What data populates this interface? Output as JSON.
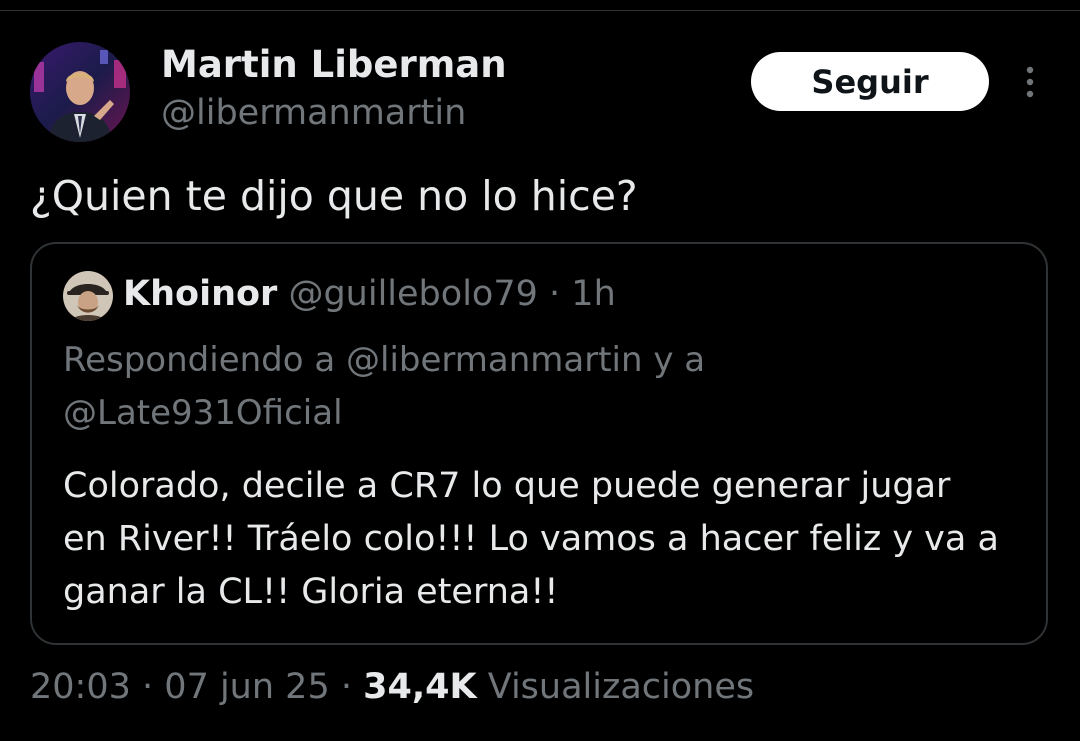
{
  "author": {
    "name": "Martin Liberman",
    "handle": "@libermanmartin"
  },
  "follow_button_label": "Seguir",
  "more_icon": "more-vertical-icon",
  "tweet": {
    "text": "¿Quien te dijo que no lo hice?"
  },
  "quote": {
    "author_name": "Khoinor",
    "author_handle": "@guillebolo79",
    "separator": "·",
    "time": "1h",
    "reply_prefix": "Respondiendo a",
    "reply_user_1": "@libermanmartin",
    "reply_join": "y a",
    "reply_user_2": "@Late931Oficial",
    "body_line_1": "Colorado, decile a CR7 lo que puede generar jugar",
    "body_line_2": "en River!! Tráelo colo!!! Lo vamos a hacer feliz y va a",
    "body_line_3": "ganar la CL!! Gloria eterna!!"
  },
  "meta": {
    "time": "20:03",
    "separator": "·",
    "date": "07 jun 25",
    "views_count": "34,4K",
    "views_label": "Visualizaciones"
  },
  "colors": {
    "background": "#000000",
    "text_primary": "#e7e9ea",
    "text_secondary": "#71767b",
    "border": "#2f3336",
    "button_bg": "#ffffff"
  }
}
